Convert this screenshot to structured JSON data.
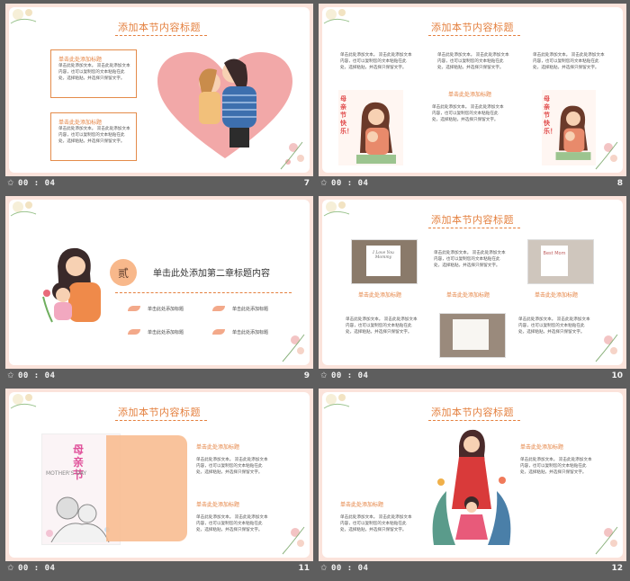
{
  "common": {
    "section_title": "添加本节内容标题",
    "sub_heading": "单击此处添加标题",
    "body_text": "单击此处添加文本。 双击此处添加文本\n内容，也可以复制您的文本粘贴在此\n处，选择粘贴，并选择只保留文字。",
    "body_wide": "单击此处添加文本， 双击此处添加文本内容，也可以复制您的文本\n粘贴在此处，选择粘贴，并选择只保留文字。",
    "duration": "00 : 04",
    "star": "✩"
  },
  "slides": [
    {
      "number": "7"
    },
    {
      "number": "8",
      "card_text": "母亲节快乐！"
    },
    {
      "number": "9",
      "chapter_char": "贰",
      "chapter_title": "单击此处添加第二章标题内容",
      "item_labels": [
        "单击此处添加标题",
        "单击此处添加标题",
        "单击此处添加标题",
        "单击此处添加标题"
      ]
    },
    {
      "number": "10",
      "photo_texts": [
        "I Love You Mommy",
        "Best Mom"
      ]
    },
    {
      "number": "11",
      "poster_title": "母亲节",
      "poster_en": "MOTHER'S DAY"
    },
    {
      "number": "12"
    }
  ],
  "colors": {
    "accent": "#e4803f",
    "pink_bg": "#fbe3db",
    "heart": "#f2a8a8",
    "peach": "#f8b88b"
  }
}
